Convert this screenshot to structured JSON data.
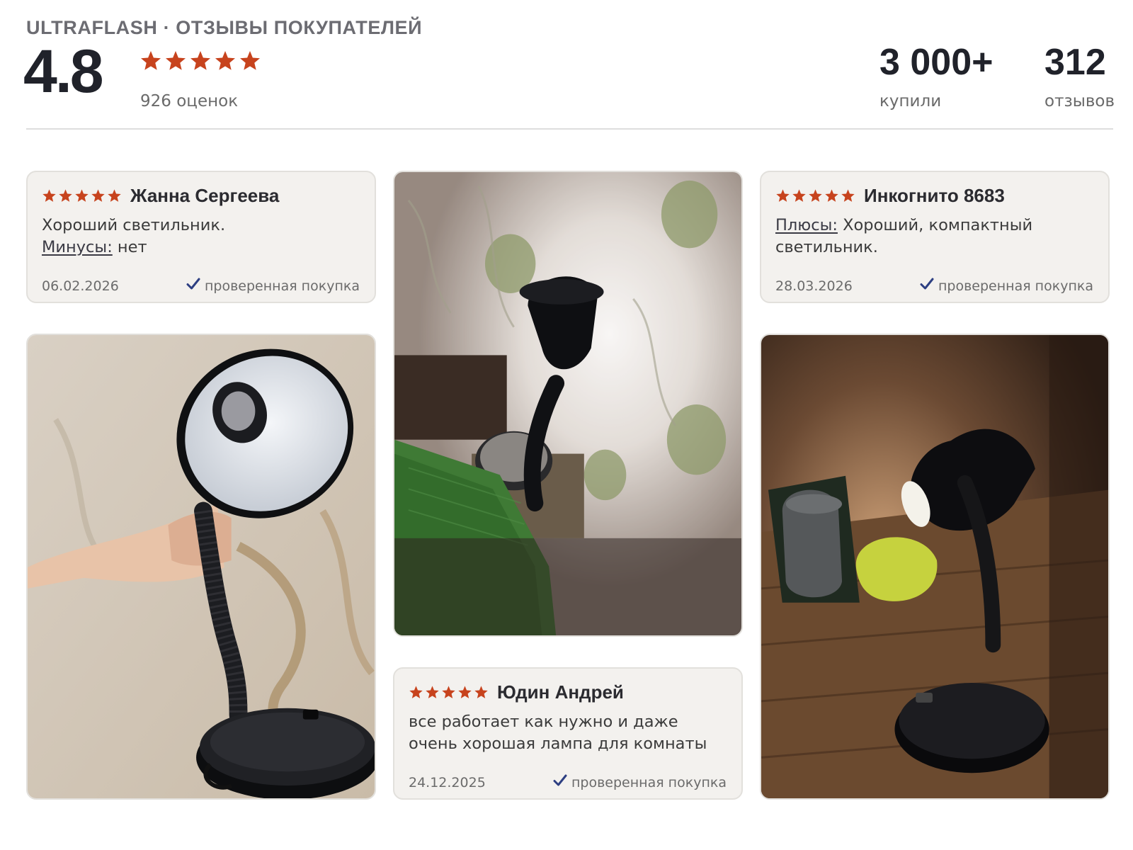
{
  "header": {
    "brand": "ULTRAFLASH · ОТЗЫВЫ ПОКУПАТЕЛЕЙ",
    "rating": "4.8",
    "rating_stars": 5,
    "rating_count": "926 оценок",
    "bought_value": "3 000+",
    "bought_label": "купили",
    "reviews_value": "312",
    "reviews_label": "отзывов"
  },
  "reviews": [
    {
      "stars": 5,
      "author": "Жанна Сергеева",
      "line1": "Хороший светильник.",
      "cons_label": "Минусы:",
      "cons_text": " нет",
      "date": "06.02.2026",
      "verified": "проверенная покупка"
    },
    {
      "stars": 5,
      "author": "Инкогнито 8683",
      "pros_label": "Плюсы:",
      "pros_text": " Хороший, компактный светильник.",
      "date": "28.03.2026",
      "verified": "проверенная покупка"
    },
    {
      "stars": 5,
      "author": "Юдин Андрей",
      "text": "все работает как нужно и даже очень хорошая лампа для комнаты",
      "date": "24.12.2025",
      "verified": "проверенная покупка"
    }
  ],
  "photos": [
    {
      "subject": "hand holding black desk lamp against patterned wallpaper"
    },
    {
      "subject": "black desk lamp lit at night by curtain"
    },
    {
      "subject": "black desk lamp glowing on wooden table"
    }
  ],
  "colors": {
    "star": "#c7431d",
    "check": "#2d3f82",
    "card_bg": "#f3f1ee",
    "heading": "#20222a"
  }
}
